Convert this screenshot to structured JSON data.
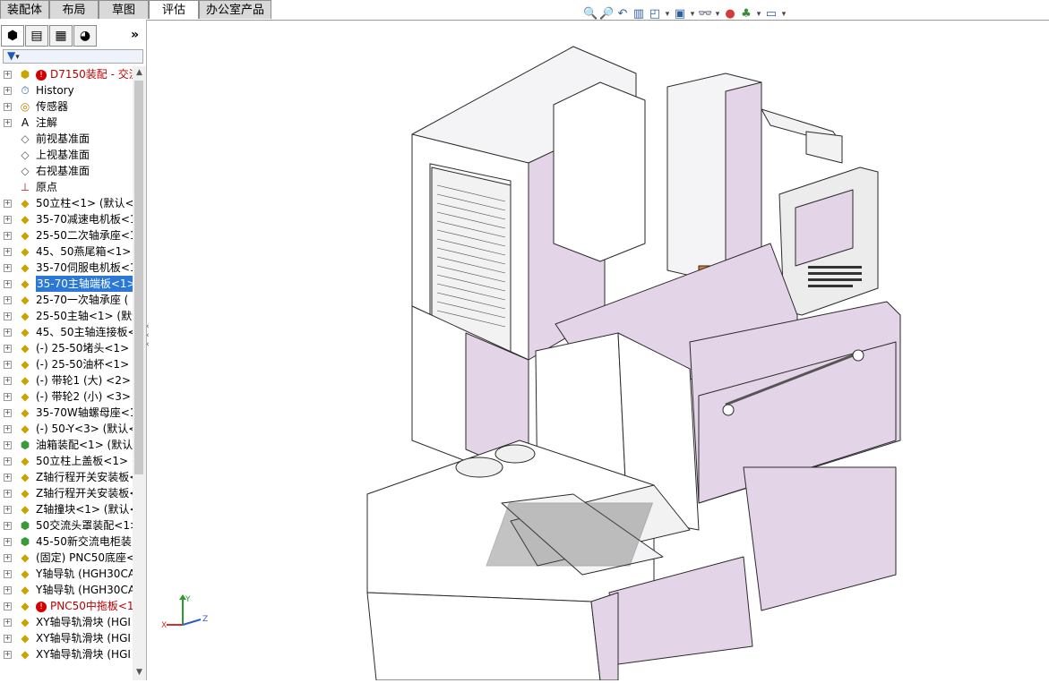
{
  "command_tabs": [
    {
      "label": "装配体"
    },
    {
      "label": "布局"
    },
    {
      "label": "草图"
    },
    {
      "label": "评估"
    },
    {
      "label": "办公室产品"
    }
  ],
  "view_toolbar": {
    "icons": [
      "zoom-to-fit-icon",
      "zoom-area-icon",
      "previous-view-icon",
      "section-view-icon",
      "view-orientation-icon",
      "display-style-icon",
      "hide-show-icon",
      "edit-appearance-icon",
      "apply-scene-icon",
      "view-settings-icon"
    ]
  },
  "panel": {
    "tabs": [
      "feature-manager-icon",
      "property-manager-icon",
      "configuration-manager-icon",
      "display-manager-icon"
    ],
    "more": "»",
    "filter_arrow": "▾",
    "tree": [
      {
        "label": "D7150装配 - 交流 -",
        "icon": "assembly-icon",
        "red": true,
        "warn": true
      },
      {
        "label": "History",
        "icon": "history-icon"
      },
      {
        "label": "传感器",
        "icon": "sensor-icon"
      },
      {
        "label": "注解",
        "icon": "annotation-icon"
      },
      {
        "label": "前视基准面",
        "icon": "plane-icon"
      },
      {
        "label": "上视基准面",
        "icon": "plane-icon"
      },
      {
        "label": "右视基准面",
        "icon": "plane-icon"
      },
      {
        "label": "原点",
        "icon": "origin-icon"
      },
      {
        "label": "50立柱<1> (默认<-",
        "icon": "part-icon"
      },
      {
        "label": "35-70减速电机板<1",
        "icon": "part-icon"
      },
      {
        "label": "25-50二次轴承座<1",
        "icon": "part-icon"
      },
      {
        "label": "45、50燕尾箱<1> (",
        "icon": "part-icon"
      },
      {
        "label": "35-70伺服电机板<1",
        "icon": "part-icon"
      },
      {
        "label": "35-70主轴端板<1>",
        "icon": "part-icon",
        "selected": true
      },
      {
        "label": "25-70一次轴承座 (",
        "icon": "part-icon"
      },
      {
        "label": "25-50主轴<1> (默认",
        "icon": "part-icon"
      },
      {
        "label": "45、50主轴连接板<",
        "icon": "part-icon"
      },
      {
        "label": "(-) 25-50堵头<1> (",
        "icon": "part-icon"
      },
      {
        "label": "(-) 25-50油杯<1> (",
        "icon": "part-icon"
      },
      {
        "label": "(-) 带轮1 (大) <2>",
        "icon": "part-icon"
      },
      {
        "label": "(-) 带轮2 (小) <3>",
        "icon": "part-icon"
      },
      {
        "label": "35-70W轴螺母座<1",
        "icon": "part-icon"
      },
      {
        "label": "(-) 50-Y<3> (默认<",
        "icon": "part-icon"
      },
      {
        "label": "油箱装配<1> (默认",
        "icon": "subassembly-icon"
      },
      {
        "label": "50立柱上盖板<1> (",
        "icon": "part-icon"
      },
      {
        "label": "Z轴行程开关安装板<",
        "icon": "part-icon"
      },
      {
        "label": "Z轴行程开关安装板<",
        "icon": "part-icon"
      },
      {
        "label": "Z轴撞块<1> (默认<",
        "icon": "part-icon"
      },
      {
        "label": "50交流头罩装配<1>",
        "icon": "subassembly-icon"
      },
      {
        "label": "45-50新交流电柜装",
        "icon": "subassembly-icon"
      },
      {
        "label": "(固定) PNC50底座<",
        "icon": "part-icon"
      },
      {
        "label": "Y轴导轨 (HGH30CA",
        "icon": "part-icon"
      },
      {
        "label": "Y轴导轨 (HGH30CA",
        "icon": "part-icon"
      },
      {
        "label": "PNC50中拖板<1",
        "icon": "part-icon",
        "red": true,
        "warn": true
      },
      {
        "label": "XY轴导轨滑块 (HGI",
        "icon": "part-icon"
      },
      {
        "label": "XY轴导轨滑块 (HGI",
        "icon": "part-icon"
      },
      {
        "label": "XY轴导轨滑块 (HGI",
        "icon": "part-icon"
      }
    ]
  },
  "triad": {
    "x": "X",
    "y": "Y",
    "z": "Z"
  }
}
